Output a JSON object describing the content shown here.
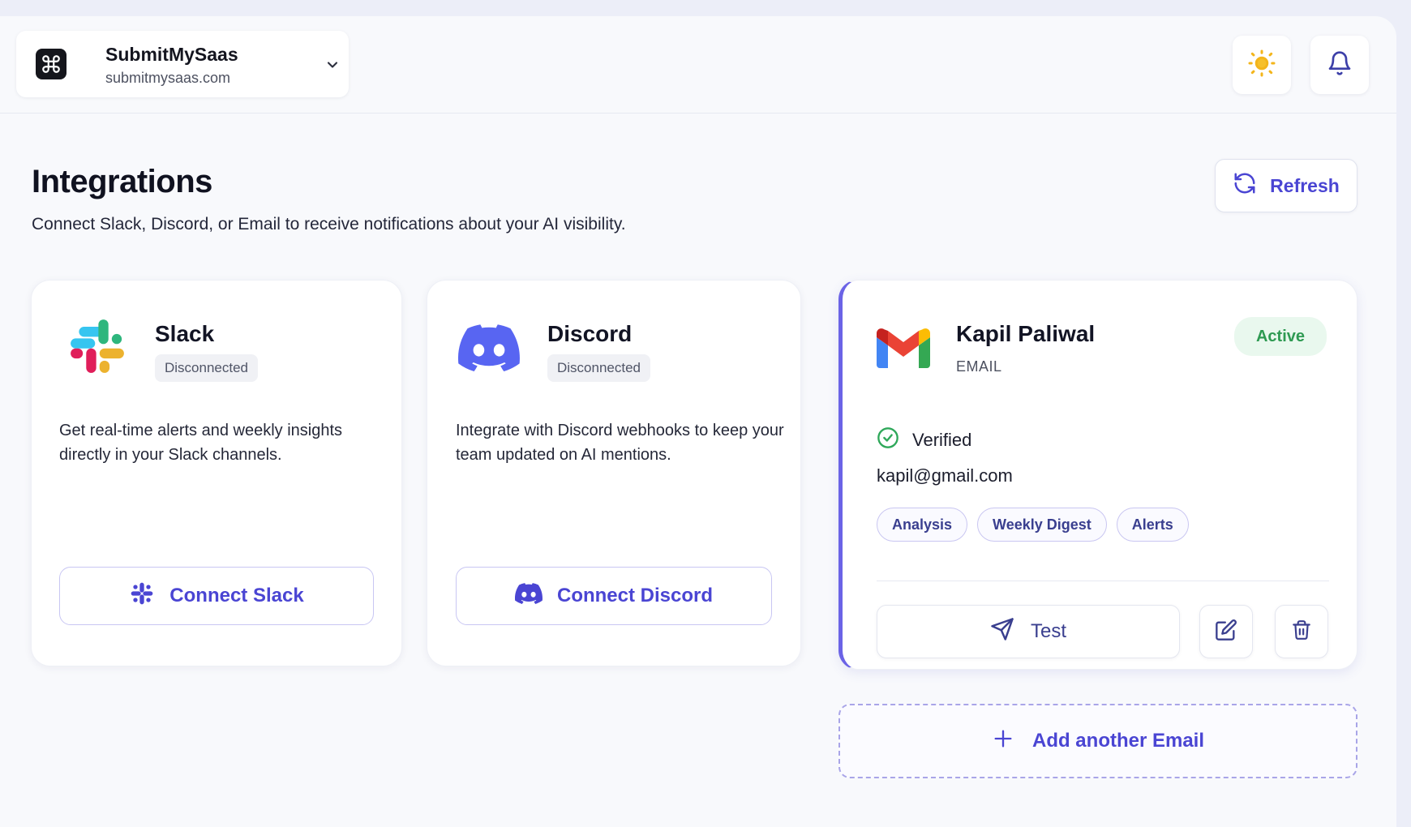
{
  "org": {
    "name": "SubmitMySaas",
    "domain": "submitmysaas.com"
  },
  "header": {
    "theme_icon": "sun-icon",
    "notifications_icon": "bell-icon"
  },
  "page": {
    "title": "Integrations",
    "subtitle": "Connect Slack, Discord, or Email to receive notifications about your AI visibility.",
    "refresh_label": "Refresh"
  },
  "slack": {
    "title": "Slack",
    "status": "Disconnected",
    "description": "Get real-time alerts and weekly insights directly in your Slack channels.",
    "button_label": "Connect Slack"
  },
  "discord": {
    "title": "Discord",
    "status": "Disconnected",
    "description": "Integrate with Discord webhooks to keep your team updated on AI mentions.",
    "button_label": "Connect Discord"
  },
  "email_card": {
    "name": "Kapil Paliwal",
    "type": "EMAIL",
    "status": "Active",
    "verified_label": "Verified",
    "address": "kapil@gmail.com",
    "tags": [
      "Analysis",
      "Weekly Digest",
      "Alerts"
    ],
    "test_label": "Test"
  },
  "add_email": {
    "label": "Add another Email"
  },
  "colors": {
    "accent": "#4a45d3",
    "active_green": "#2e9a52",
    "email_border": "#6b63e6"
  }
}
